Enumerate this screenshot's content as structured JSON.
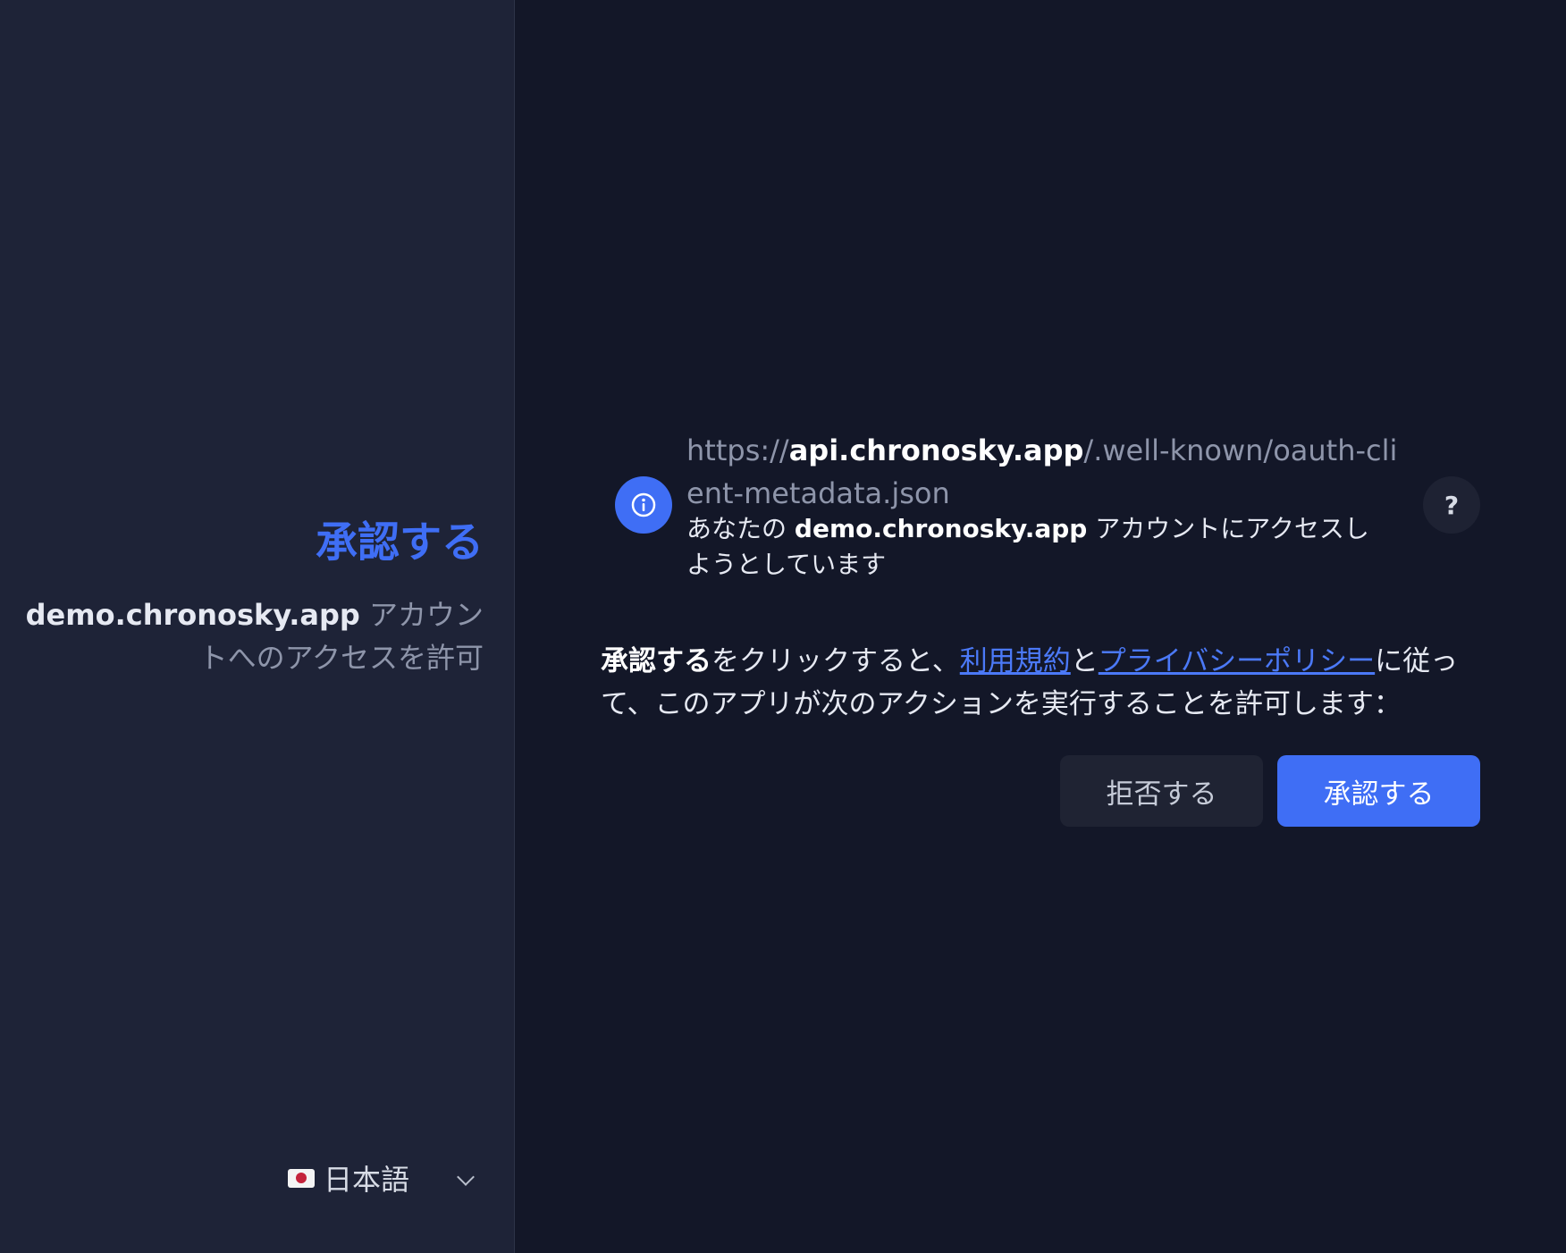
{
  "sidebar": {
    "title": "承認する",
    "host": "demo.chronosky.app",
    "description_rest": " アカウントへのアクセスを許可",
    "language": {
      "flag_icon": "japan-flag-icon",
      "label": "日本語"
    }
  },
  "client": {
    "url_prefix": "https://",
    "url_domain": "api.chronosky.app",
    "url_path": "/.well-known/oauth-client-metadata.json",
    "sub_pre": "あなたの ",
    "sub_host": "demo.chronosky.app",
    "sub_post": " アカウントにアクセスしようとしています",
    "help_label": "?"
  },
  "consent": {
    "bold": "承認する",
    "text1": "をクリックすると、",
    "terms_link": "利用規約",
    "text2": "と",
    "privacy_link": "プライバシーポリシー",
    "text3": "に従って、このアプリが次のアクションを実行することを許可します："
  },
  "buttons": {
    "deny": "拒否する",
    "approve": "承認する"
  },
  "colors": {
    "accent": "#3f6ef5",
    "sidebar_bg": "#1e2337",
    "main_bg": "#131728"
  }
}
